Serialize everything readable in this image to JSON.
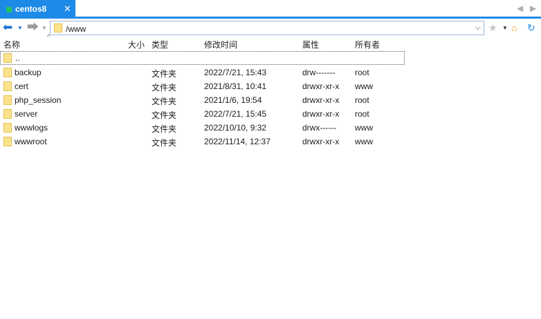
{
  "tab": {
    "title": "centos8",
    "close": "✕"
  },
  "tabbar_nav": {
    "prev": "◀",
    "next": "▶"
  },
  "toolbar": {
    "back_icon": "back-arrow-icon",
    "forward_icon": "forward-arrow-icon",
    "path": "/www",
    "icons": [
      "star-icon",
      "home-folder-icon",
      "refresh-icon"
    ]
  },
  "columns": {
    "name": "名称",
    "size": "大小",
    "type": "类型",
    "modified": "修改时间",
    "perm": "属性",
    "owner": "所有者"
  },
  "parent_entry": "..",
  "files": [
    {
      "name": "backup",
      "type": "文件夹",
      "modified": "2022/7/21, 15:43",
      "perm": "drw-------",
      "owner": "root"
    },
    {
      "name": "cert",
      "type": "文件夹",
      "modified": "2021/8/31, 10:41",
      "perm": "drwxr-xr-x",
      "owner": "www"
    },
    {
      "name": "php_session",
      "type": "文件夹",
      "modified": "2021/1/6, 19:54",
      "perm": "drwxr-xr-x",
      "owner": "root"
    },
    {
      "name": "server",
      "type": "文件夹",
      "modified": "2022/7/21, 15:45",
      "perm": "drwxr-xr-x",
      "owner": "root"
    },
    {
      "name": "wwwlogs",
      "type": "文件夹",
      "modified": "2022/10/10, 9:32",
      "perm": "drwx------",
      "owner": "www"
    },
    {
      "name": "wwwroot",
      "type": "文件夹",
      "modified": "2022/11/14, 12:37",
      "perm": "drwxr-xr-x",
      "owner": "www"
    }
  ],
  "colors": {
    "accent": "#1e8ae8",
    "folder": "#fbe38e",
    "status_dot": "#22c55e"
  }
}
